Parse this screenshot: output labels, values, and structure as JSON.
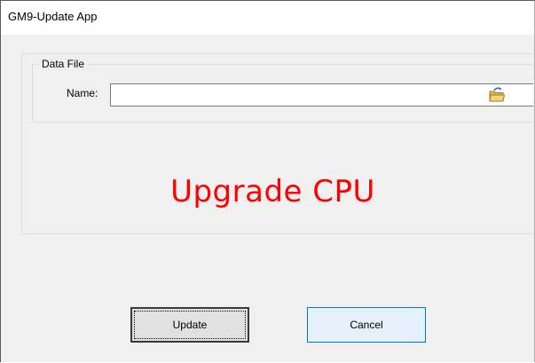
{
  "window": {
    "title": "GM9-Update App"
  },
  "data_file": {
    "legend": "Data File",
    "name_label": "Name:",
    "name_value": "",
    "browse_icon": "folder-open-icon"
  },
  "banner": {
    "text": "Upgrade CPU",
    "color": "#ff0000"
  },
  "buttons": {
    "update_label": "Update",
    "cancel_label": "Cancel"
  }
}
